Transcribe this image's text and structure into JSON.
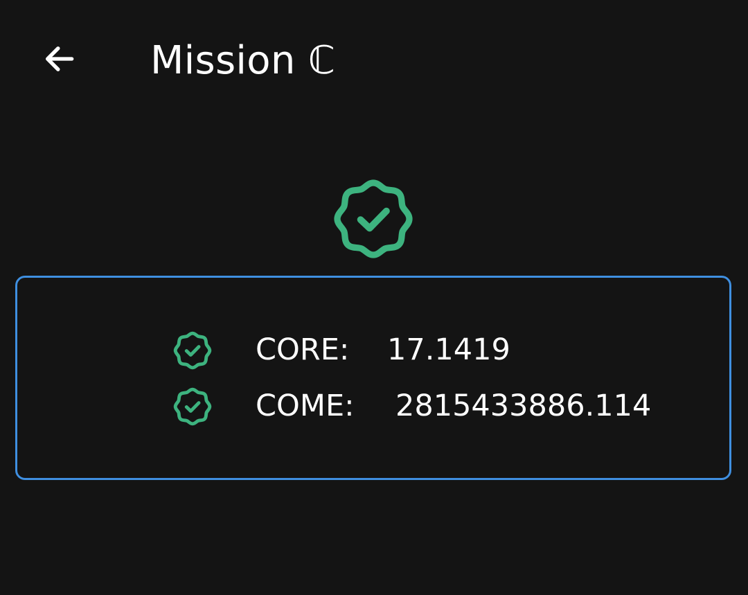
{
  "app_bar": {
    "title": "Mission ℂ",
    "back_icon": "arrow-left-icon"
  },
  "status": {
    "icon": "verified-badge-icon",
    "color": "#3db37f"
  },
  "card": {
    "border_color": "#3f8fe0",
    "rows": [
      {
        "icon": "verified-badge-icon",
        "label": "CORE:",
        "value": "17.1419"
      },
      {
        "icon": "verified-badge-icon",
        "label": "COME:",
        "value": "2815433886.114"
      }
    ]
  }
}
